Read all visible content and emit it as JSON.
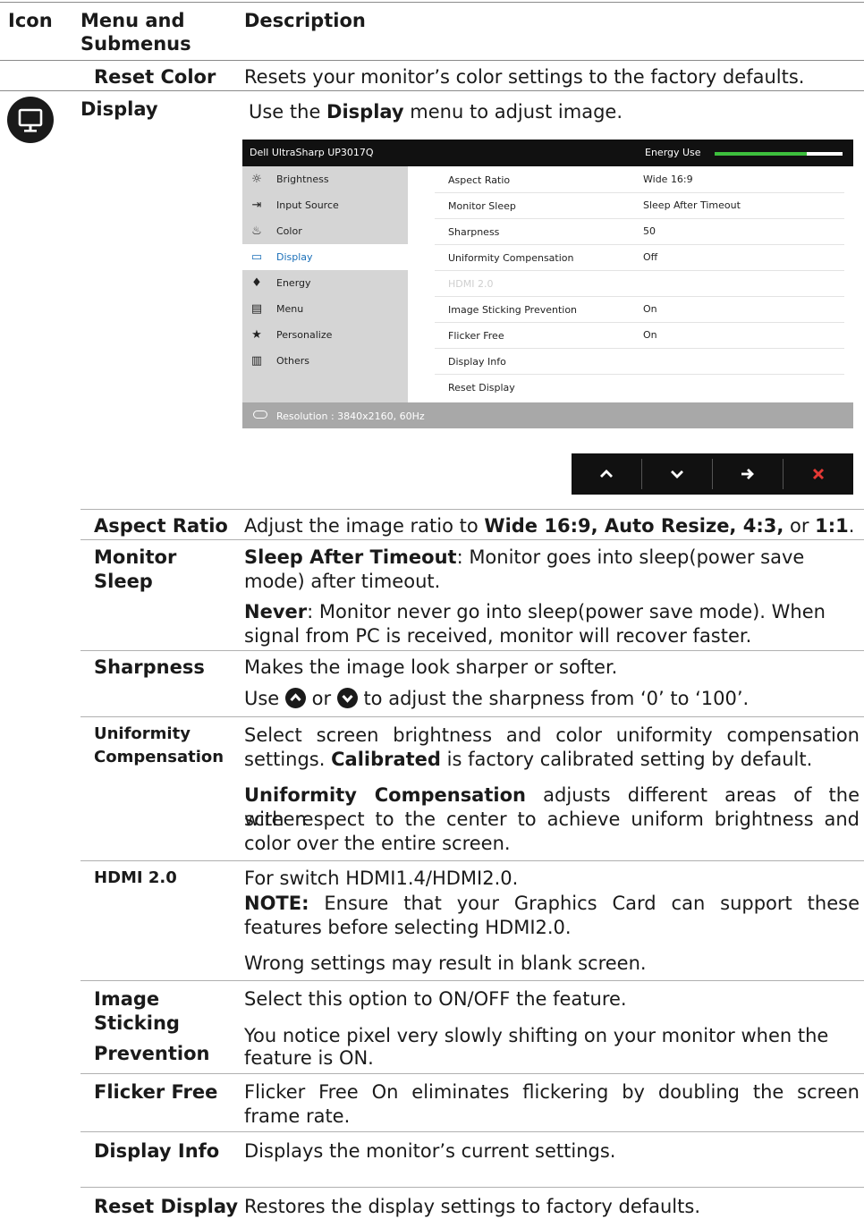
{
  "header": {
    "icon": "Icon",
    "menu_line1": "Menu and",
    "menu_line2": "Submenus",
    "description": "Description"
  },
  "reset_color": {
    "name": "Reset Color",
    "desc": "Resets your monitor’s color settings to the factory defaults."
  },
  "display": {
    "name": "Display",
    "desc_pre": "Use the ",
    "desc_bold": "Display",
    "desc_post": " menu to adjust image."
  },
  "osd": {
    "title": "Dell UltraSharp UP3017Q",
    "energy_label": "Energy Use",
    "energy_level": 0.72,
    "menu": [
      {
        "label": "Brightness",
        "icon": "brightness-icon",
        "glyph": "☼"
      },
      {
        "label": "Input Source",
        "icon": "input-source-icon",
        "glyph": "⇥"
      },
      {
        "label": "Color",
        "icon": "color-icon",
        "glyph": "♨"
      },
      {
        "label": "Display",
        "icon": "display-icon",
        "glyph": "▭"
      },
      {
        "label": "Energy",
        "icon": "energy-icon",
        "glyph": "♦"
      },
      {
        "label": "Menu",
        "icon": "menu-icon",
        "glyph": "▤"
      },
      {
        "label": "Personalize",
        "icon": "star-icon",
        "glyph": "★"
      },
      {
        "label": "Others",
        "icon": "others-icon",
        "glyph": "▥"
      }
    ],
    "rows": [
      {
        "key": "Aspect Ratio",
        "value": "Wide 16:9"
      },
      {
        "key": "Monitor Sleep",
        "value": "Sleep After Timeout"
      },
      {
        "key": "Sharpness",
        "value": "50"
      },
      {
        "key": "Uniformity Compensation",
        "value": "Off"
      },
      {
        "key": "HDMI 2.0",
        "value": ""
      },
      {
        "key": "Image Sticking Prevention",
        "value": "On"
      },
      {
        "key": "Flicker Free",
        "value": "On"
      },
      {
        "key": "Display Info",
        "value": ""
      },
      {
        "key": "Reset Display",
        "value": ""
      }
    ],
    "resolution": "Resolution : 3840x2160, 60Hz"
  },
  "nav_buttons": [
    {
      "glyph": "⌃",
      "name": "up-button",
      "color": "#ffffff"
    },
    {
      "glyph": "⌄",
      "name": "down-button",
      "color": "#ffffff"
    },
    {
      "glyph": "➔",
      "name": "next-button",
      "color": "#ffffff"
    },
    {
      "glyph": "✖",
      "name": "exit-button",
      "color": "#e53935"
    }
  ],
  "aspect_ratio": {
    "name": "Aspect Ratio",
    "pre": "Adjust the image ratio to ",
    "opts": "Wide 16:9, Auto Resize, 4:3,",
    "or": " or ",
    "last": "1:1",
    "end": "."
  },
  "monitor_sleep": {
    "name1": "Monitor",
    "name2": "Sleep",
    "p1_bold": "Sleep After Timeout",
    "p1_line1": ": Monitor goes into sleep(power save",
    "p1_line2": "mode) after timeout.",
    "p2_bold": "Never",
    "p2_line1": ": Monitor never go into sleep(power save mode).  When",
    "p2_line2": "signal from PC is received, monitor will recover faster."
  },
  "sharpness": {
    "name": "Sharpness",
    "line1": "Makes the image look sharper or softer.",
    "use": "Use ",
    "or": " or ",
    "rest": " to adjust the sharpness from ‘0’ to ‘100’."
  },
  "uniformity": {
    "name1": "Uniformity",
    "name2": "Compensation",
    "p1_line1": "Select screen brightness and color uniformity compensation",
    "p1_line2_bold": "Calibrated",
    "p1_line2": " is factory calibrated setting by default.",
    "p1_line2_pre": "settings. ",
    "p2_bold": "Uniformity Compensation",
    "p2_line1": " adjusts different areas of the screen",
    "p2_line2": "with respect to the center to achieve uniform brightness and",
    "p2_line3": "color over the entire screen."
  },
  "hdmi": {
    "name": "HDMI 2.0",
    "line1": "For switch HDMI1.4/HDMI2.0.",
    "note_bold": "NOTE:",
    "note_line1": " Ensure that your Graphics Card can support these",
    "note_line2": "features before selecting HDMI2.0.",
    "line3": "Wrong settings may result in blank screen."
  },
  "image_sticking": {
    "name1": "Image",
    "name2": "Sticking",
    "name3": "Prevention",
    "line1": "Select this option to ON/OFF the feature.",
    "line2": "You notice pixel very slowly shifting on your monitor when the",
    "line3": "feature is ON."
  },
  "flicker": {
    "name": "Flicker Free",
    "line1": "Flicker Free On eliminates flickering by doubling the screen",
    "line2": "frame rate."
  },
  "display_info": {
    "name": "Display Info",
    "desc": "Displays the monitor’s current settings."
  },
  "reset_display": {
    "name": "Reset Display",
    "desc": "Restores the display settings to factory defaults."
  }
}
